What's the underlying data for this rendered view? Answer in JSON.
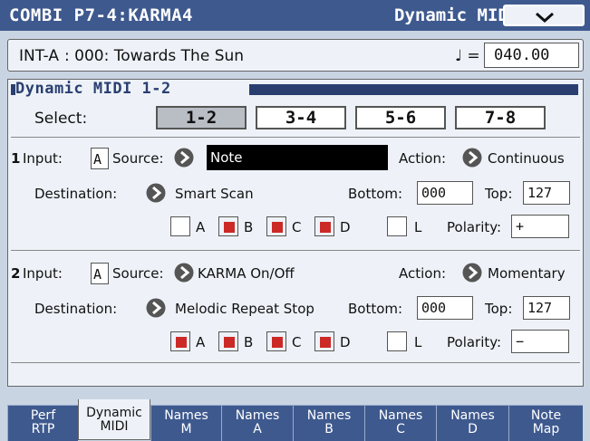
{
  "header": {
    "title": "COMBI  P7-4:KARMA4",
    "page": "Dynamic MIDI",
    "menu_icon": "chevron-down-icon"
  },
  "info": {
    "bank": "INT-A",
    "program": ": 000: Towards The Sun",
    "tempo_label": "♩ =",
    "tempo": "040.00"
  },
  "section": {
    "title": "Dynamic MIDI 1-2"
  },
  "select": {
    "label": "Select:",
    "options": [
      "1-2",
      "3-4",
      "5-6",
      "7-8"
    ],
    "selected": "1-2"
  },
  "entries": [
    {
      "num": "1",
      "input_label": "Input:",
      "input": "A",
      "source_label": "Source:",
      "source": "Note",
      "action_label": "Action:",
      "action": "Continuous",
      "destination_label": "Destination:",
      "destination": "Smart Scan",
      "bottom_label": "Bottom:",
      "bottom": "000",
      "top_label": "Top:",
      "top": "127",
      "checks": [
        {
          "label": "A",
          "checked": false
        },
        {
          "label": "B",
          "checked": true
        },
        {
          "label": "C",
          "checked": true
        },
        {
          "label": "D",
          "checked": true
        },
        {
          "label": "L",
          "checked": false
        }
      ],
      "polarity_label": "Polarity:",
      "polarity": "+"
    },
    {
      "num": "2",
      "input_label": "Input:",
      "input": "A",
      "source_label": "Source:",
      "source": "KARMA On/Off",
      "action_label": "Action:",
      "action": "Momentary",
      "destination_label": "Destination:",
      "destination": "Melodic Repeat Stop",
      "bottom_label": "Bottom:",
      "bottom": "000",
      "top_label": "Top:",
      "top": "127",
      "checks": [
        {
          "label": "A",
          "checked": true
        },
        {
          "label": "B",
          "checked": true
        },
        {
          "label": "C",
          "checked": true
        },
        {
          "label": "D",
          "checked": true
        },
        {
          "label": "L",
          "checked": false
        }
      ],
      "polarity_label": "Polarity:",
      "polarity": "−"
    }
  ],
  "tabs": [
    {
      "l1": "Perf",
      "l2": "RTP"
    },
    {
      "l1": "Dynamic",
      "l2": "MIDI"
    },
    {
      "l1": "Names",
      "l2": "M"
    },
    {
      "l1": "Names",
      "l2": "A"
    },
    {
      "l1": "Names",
      "l2": "B"
    },
    {
      "l1": "Names",
      "l2": "C"
    },
    {
      "l1": "Names",
      "l2": "D"
    },
    {
      "l1": "Note",
      "l2": "Map"
    }
  ],
  "active_tab": "Dynamic MIDI",
  "colors": {
    "title_bar": "#3e598e",
    "panel": "#eef2f8",
    "checkbox_on": "#cc2a26",
    "source_field": "#000000"
  }
}
